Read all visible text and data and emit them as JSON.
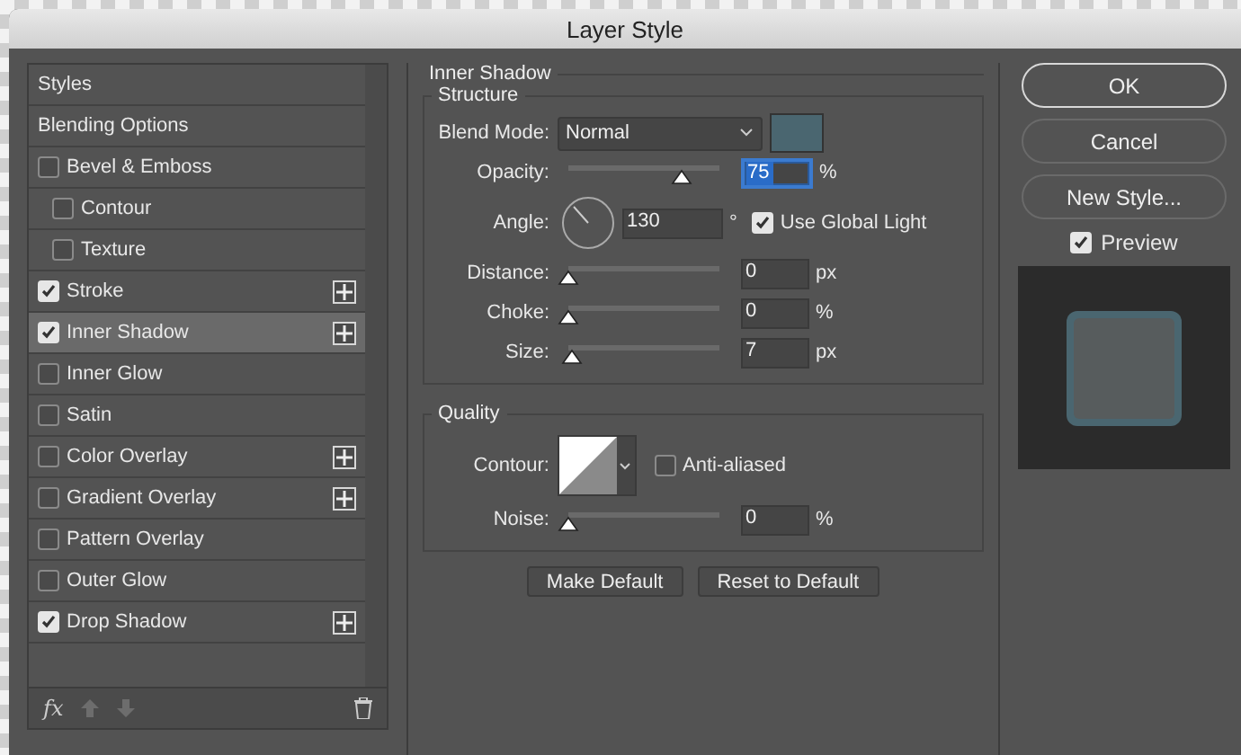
{
  "window": {
    "title": "Layer Style"
  },
  "styles": [
    {
      "label": "Styles",
      "kind": "header",
      "selected": false
    },
    {
      "label": "Blending Options",
      "kind": "header",
      "selected": false
    },
    {
      "label": "Bevel & Emboss",
      "kind": "option",
      "checked": false,
      "selected": false,
      "addable": false,
      "children": [
        {
          "label": "Contour",
          "kind": "option",
          "checked": false,
          "selected": false,
          "addable": false
        },
        {
          "label": "Texture",
          "kind": "option",
          "checked": false,
          "selected": false,
          "addable": false
        }
      ]
    },
    {
      "label": "Stroke",
      "kind": "option",
      "checked": true,
      "selected": false,
      "addable": true
    },
    {
      "label": "Inner Shadow",
      "kind": "option",
      "checked": true,
      "selected": true,
      "addable": true
    },
    {
      "label": "Inner Glow",
      "kind": "option",
      "checked": false,
      "selected": false,
      "addable": false
    },
    {
      "label": "Satin",
      "kind": "option",
      "checked": false,
      "selected": false,
      "addable": false
    },
    {
      "label": "Color Overlay",
      "kind": "option",
      "checked": false,
      "selected": false,
      "addable": true
    },
    {
      "label": "Gradient Overlay",
      "kind": "option",
      "checked": false,
      "selected": false,
      "addable": true
    },
    {
      "label": "Pattern Overlay",
      "kind": "option",
      "checked": false,
      "selected": false,
      "addable": false
    },
    {
      "label": "Outer Glow",
      "kind": "option",
      "checked": false,
      "selected": false,
      "addable": false
    },
    {
      "label": "Drop Shadow",
      "kind": "option",
      "checked": true,
      "selected": false,
      "addable": true
    }
  ],
  "panel": {
    "title": "Inner Shadow",
    "structure": {
      "title": "Structure",
      "rows": [
        {
          "kind": "select",
          "label": "Blend Mode:",
          "value": "Normal"
        },
        {
          "kind": "slider",
          "label": "Opacity:",
          "level": 0.75,
          "value": "75",
          "unit": "%",
          "focused": true
        },
        {
          "kind": "angle",
          "label": "Angle:",
          "value": "130",
          "unit": "°",
          "checkbox": {
            "label": "Use Global Light",
            "checked": true
          }
        },
        {
          "kind": "slider",
          "label": "Distance:",
          "level": 0,
          "value": "0",
          "unit": "px",
          "focused": false
        },
        {
          "kind": "slider",
          "label": "Choke:",
          "level": 0,
          "value": "0",
          "unit": "%",
          "focused": false
        },
        {
          "kind": "slider",
          "label": "Size:",
          "level": 0.03,
          "value": "7",
          "unit": "px",
          "focused": false
        }
      ]
    },
    "quality": {
      "title": "Quality",
      "rows": [
        {
          "kind": "contour",
          "label": "Contour:",
          "checkbox": {
            "label": "Anti-aliased",
            "checked": false
          }
        },
        {
          "kind": "slider",
          "label": "Noise:",
          "level": 0,
          "value": "0",
          "unit": "%",
          "focused": false
        }
      ]
    },
    "buttons": [
      "Make Default",
      "Reset to Default"
    ]
  },
  "effects_button": "fx",
  "actions": [
    {
      "label": "OK",
      "default": true
    },
    {
      "label": "Cancel",
      "default": false
    },
    {
      "label": "New Style...",
      "default": false
    }
  ],
  "preview": {
    "label": "Preview",
    "checked": true
  }
}
